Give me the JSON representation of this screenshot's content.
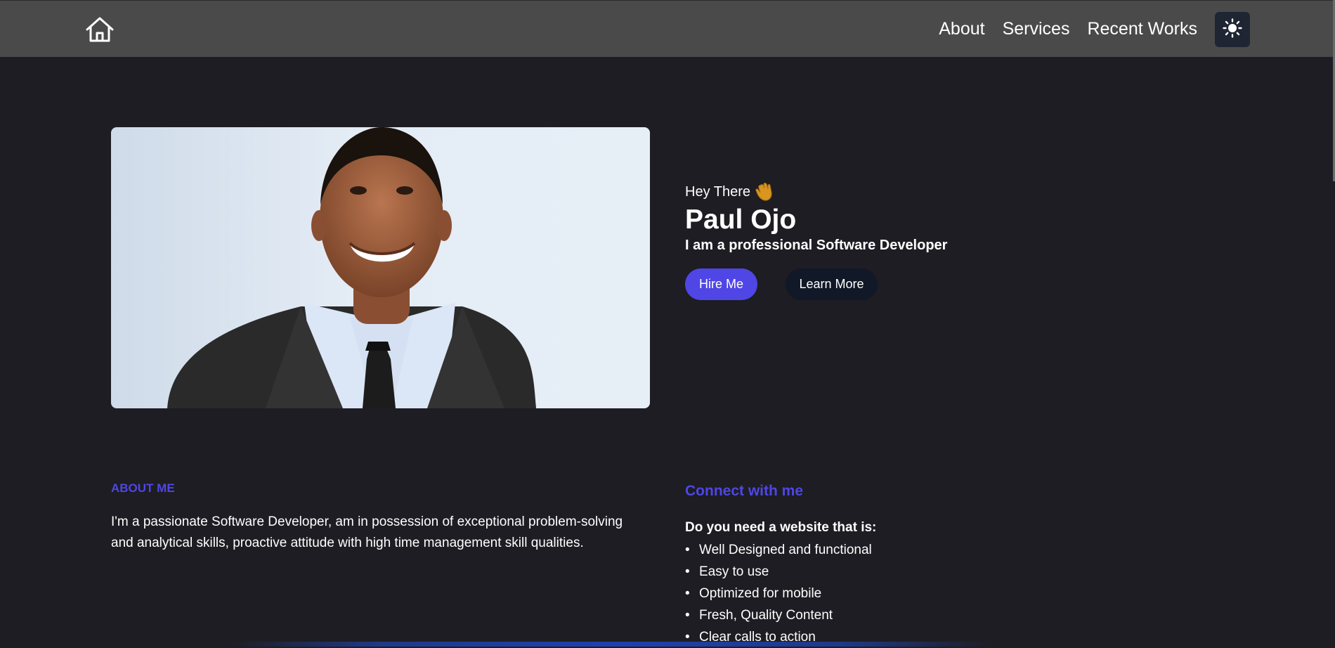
{
  "nav": {
    "links": [
      "About",
      "Services",
      "Recent Works"
    ],
    "icons": {
      "home": "home-icon",
      "theme": "sun-icon"
    }
  },
  "hero": {
    "greeting": "Hey There",
    "greeting_icon": "waving-hand-icon",
    "name": "Paul Ojo",
    "role": "I am a professional Software Developer",
    "primary_button": "Hire Me",
    "secondary_button": "Learn More",
    "photo": "portrait-photo"
  },
  "about": {
    "heading": "ABOUT ME",
    "text": "I'm a passionate Software Developer, am in possession of exceptional problem-solving and analytical skills, proactive attitude with high time management skill qualities."
  },
  "connect": {
    "heading": "Connect with me",
    "question": "Do you need a website that is:",
    "items": [
      "Well Designed and functional",
      "Easy to use",
      "Optimized for mobile",
      "Fresh, Quality Content",
      "Clear calls to action"
    ]
  },
  "colors": {
    "background": "#1d1d23",
    "navbar": "#4a4a4a",
    "accent": "#4f46e5",
    "secondary_button": "#111827"
  }
}
